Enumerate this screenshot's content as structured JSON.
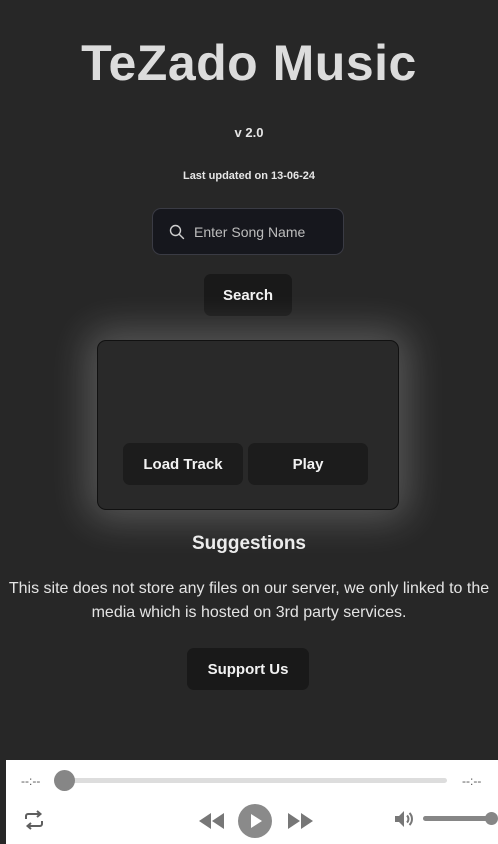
{
  "app": {
    "title": "TeZado Music",
    "version": "v 2.0",
    "last_updated": "Last updated on 13-06-24"
  },
  "search": {
    "placeholder": "Enter Song Name",
    "value": "",
    "button_label": "Search",
    "icon": "search-icon"
  },
  "player_card": {
    "load_label": "Load Track",
    "play_label": "Play"
  },
  "suggestions": {
    "heading": "Suggestions"
  },
  "disclaimer": "This site does not store any files on our server, we only linked to the media which is hosted on 3rd party services.",
  "support": {
    "button_label": "Support Us"
  },
  "audio_player": {
    "current_time": "--:--",
    "duration": "--:--",
    "progress": 0,
    "volume": 1.0,
    "icons": [
      "loop-icon",
      "rewind-icon",
      "play-icon",
      "fast-forward-icon",
      "volume-icon"
    ]
  },
  "colors": {
    "background": "#272727",
    "button": "#191919",
    "player_bar": "#ffffff",
    "player_accent": "#868686"
  }
}
